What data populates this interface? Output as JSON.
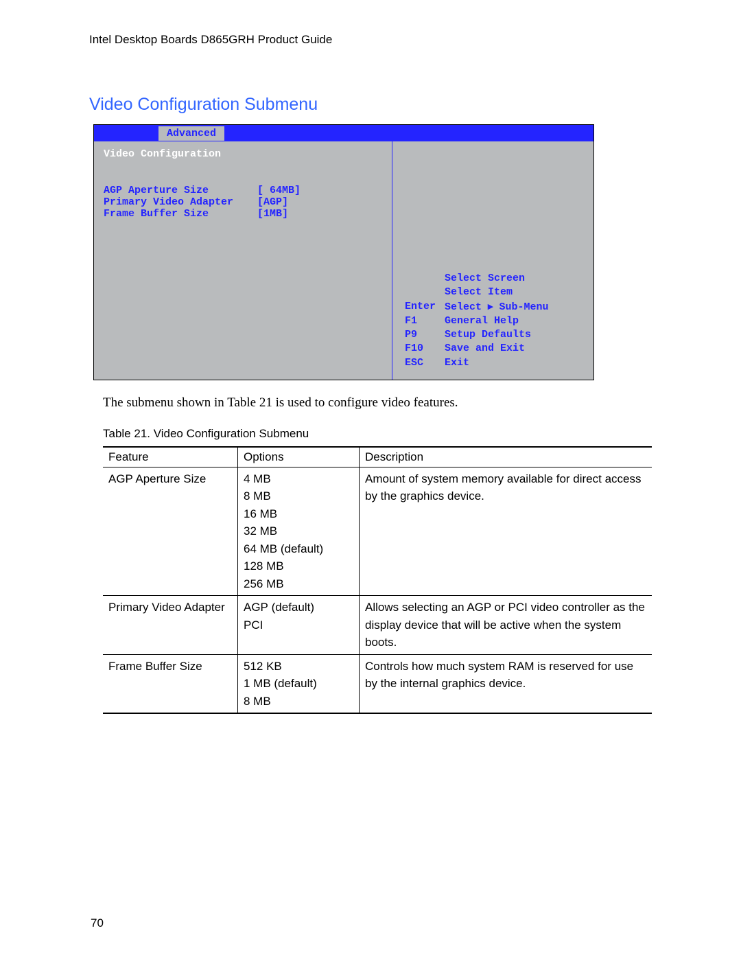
{
  "header": "Intel Desktop Boards D865GRH Product Guide",
  "section_heading": "Video Configuration Submenu",
  "bios": {
    "active_tab": "Advanced",
    "panel_title": "Video Configuration",
    "settings": [
      {
        "label": "AGP Aperture Size",
        "value": "[ 64MB]"
      },
      {
        "label": "Primary Video Adapter",
        "value": "[AGP]"
      },
      {
        "label": "Frame Buffer Size",
        "value": "[1MB]"
      }
    ],
    "help": [
      {
        "key": "",
        "action": "Select Screen"
      },
      {
        "key": "",
        "action": "Select Item"
      },
      {
        "key": "Enter",
        "action_prefix": "Select ",
        "arrow": "▸",
        "action_suffix": " Sub-Menu"
      },
      {
        "key": "F1",
        "action": "General Help"
      },
      {
        "key": "P9",
        "action": "Setup Defaults"
      },
      {
        "key": "F10",
        "action": "Save and Exit"
      },
      {
        "key": "ESC",
        "action": "Exit"
      }
    ]
  },
  "body_para": "The submenu shown in Table 21 is used to configure video features.",
  "table_caption": "Table 21.    Video Configuration Submenu",
  "table": {
    "headers": [
      "Feature",
      "Options",
      "Description"
    ],
    "rows": [
      {
        "feature": "AGP Aperture Size",
        "options": [
          "4 MB",
          "8 MB",
          "16 MB",
          "32 MB",
          "64 MB (default)",
          "128 MB",
          "256 MB"
        ],
        "description": "Amount of system memory available for direct access by the graphics device."
      },
      {
        "feature": "Primary Video Adapter",
        "options": [
          "AGP (default)",
          "PCI"
        ],
        "description": "Allows selecting an AGP or PCI video controller as the display device that will be active when the system boots."
      },
      {
        "feature": "Frame Buffer Size",
        "options": [
          "512 KB",
          "1 MB (default)",
          "8 MB"
        ],
        "description": "Controls how much system RAM is reserved for use by the internal graphics device."
      }
    ]
  },
  "page_number": "70"
}
